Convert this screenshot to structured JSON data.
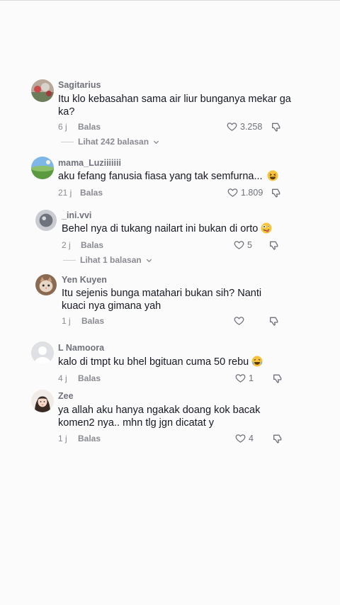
{
  "comments": [
    {
      "username": "Sagitarius",
      "text": "Itu klo kebasahan sama air liur bunganya mekar ga ka?",
      "time": "6 j",
      "reply_label": "Balas",
      "likes": "3.258",
      "view_replies": "Lihat 242 balasan",
      "avatar_icon": "avatar-flowers"
    },
    {
      "username": "mama_Luziiiiiii",
      "text": "aku fefang fanusia fiasa yang tak semfurna...",
      "emoji": "grinning-squint-emoji",
      "time": "21 j",
      "reply_label": "Balas",
      "likes": "1.809",
      "avatar_icon": "avatar-landscape"
    },
    {
      "username": "_ini.vvi",
      "text": "Behel nya di tukang nailart ini bukan di orto",
      "emoji": "zany-face-emoji",
      "time": "2 j",
      "reply_label": "Balas",
      "likes": "5",
      "view_replies": "Lihat 1 balasan",
      "avatar_icon": "avatar-ball"
    },
    {
      "username": "Yen Kuyen",
      "text": "Itu sejenis bunga matahari bukan sih? Nanti kuaci nya gimana yah",
      "time": "1 j",
      "reply_label": "Balas",
      "likes": "",
      "avatar_icon": "avatar-cat"
    },
    {
      "username": "L Namoora",
      "text": "kalo di tmpt ku bhel bgituan cuma 50 rebu",
      "emoji": "laughing-crying-emoji",
      "time": "4 j",
      "reply_label": "Balas",
      "likes": "1",
      "avatar_icon": "avatar-default-person"
    },
    {
      "username": "Zee",
      "text": "ya allah aku hanya ngakak doang kok bacak komen2 nya.. mhn tlg jgn dicatat y",
      "time": "1 j",
      "reply_label": "Balas",
      "likes": "4",
      "avatar_icon": "avatar-girl"
    }
  ],
  "colors": {
    "background": "#fbfbfb",
    "text": "#161823",
    "username": "#6f717a",
    "meta": "#8a8b91"
  }
}
